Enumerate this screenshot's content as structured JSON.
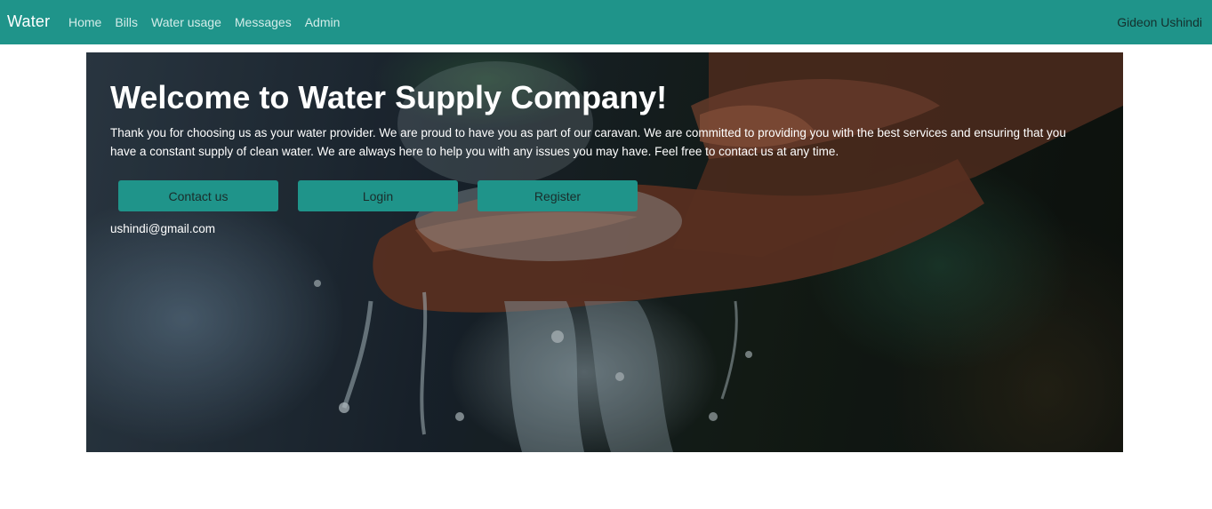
{
  "navbar": {
    "brand": "Water",
    "links": [
      {
        "label": "Home"
      },
      {
        "label": "Bills"
      },
      {
        "label": "Water usage"
      },
      {
        "label": "Messages"
      },
      {
        "label": "Admin"
      }
    ],
    "user_name": "Gideon Ushindi"
  },
  "hero": {
    "title": "Welcome to Water Supply Company!",
    "description": "Thank you for choosing us as your water provider. We are proud to have you as part of our caravan. We are committed to providing you with the best services and ensuring that you have a constant supply of clean water. We are always here to help you with any issues you may have. Feel free to contact us at any time.",
    "buttons": {
      "contact": "Contact us",
      "login": "Login",
      "register": "Register"
    },
    "email": "ushindi@gmail.com"
  },
  "colors": {
    "primary": "#1f948a",
    "nav_link": "#d3ece9",
    "hero_text": "#ffffff"
  },
  "images": {
    "hero_background": "hands-cupping-water-photo"
  }
}
